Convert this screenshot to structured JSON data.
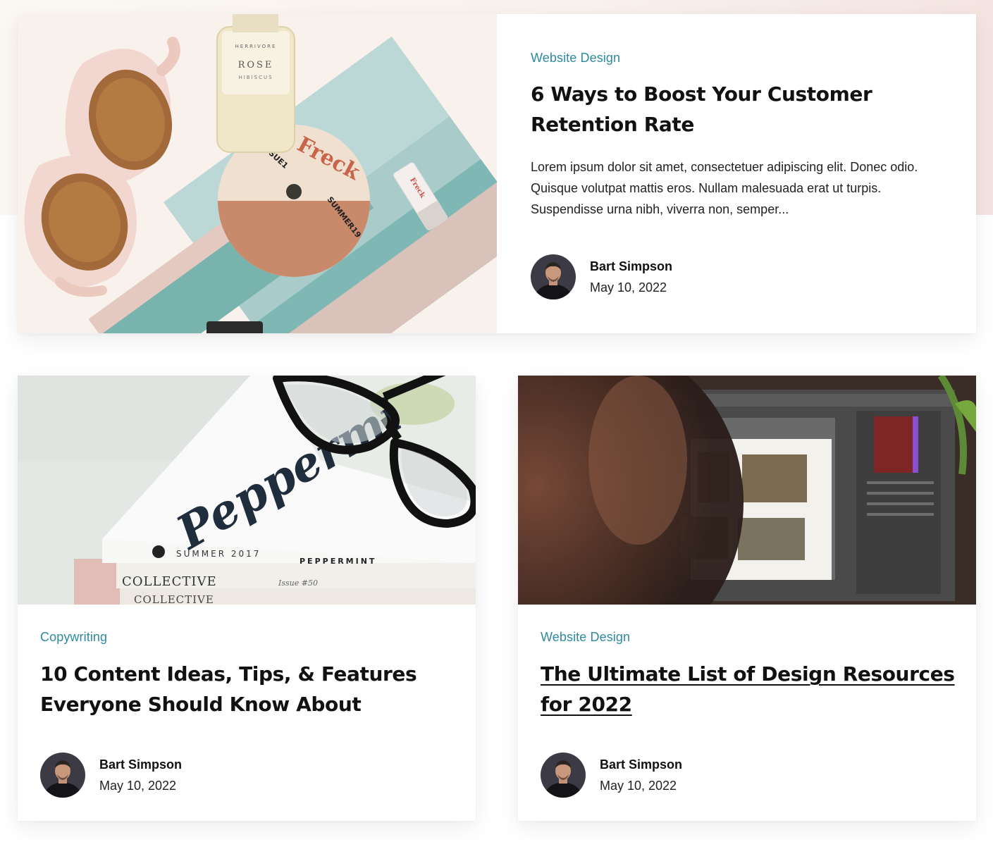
{
  "posts": [
    {
      "category": "Website Design",
      "title": "6 Ways to Boost Your Customer Retention Rate",
      "excerpt": "Lorem ipsum dolor sit amet, consectetuer adipiscing elit. Donec odio. Quisque volutpat mattis eros. Nullam malesuada erat ut turpis. Suspendisse urna nibh, viverra non, semper...",
      "author": "Bart Simpson",
      "date": "May 10, 2022",
      "image": {
        "bottle_brand": "HERRIVORE",
        "bottle_name": "ROSE",
        "bottle_sub": "HIBISCUS",
        "disc_brand": "Freck",
        "disc_left": "ISSUE1",
        "disc_right": "SUMMER19",
        "tube_brand": "Freck"
      }
    },
    {
      "category": "Copywriting",
      "title": "10 Content Ideas, Tips, & Features Everyone Should Know About",
      "author": "Bart Simpson",
      "date": "May 10, 2022",
      "image": {
        "cover_script": "Peppermi",
        "spine_left": "SUMMER 2017",
        "spine_right": "PEPPERMINT",
        "book_two": "COLLECTIVE",
        "book_two_issue": "Issue #50",
        "book_three": "COLLECTIVE"
      }
    },
    {
      "category": "Website Design",
      "title": "The Ultimate List of Design Resources for 2022",
      "author": "Bart Simpson",
      "date": "May 10, 2022"
    }
  ],
  "colors": {
    "category": "#2e8aa0",
    "title": "#111111",
    "text": "#222222",
    "band": "#f9f1ec"
  },
  "icons": {
    "avatar": "author-avatar-photo"
  }
}
